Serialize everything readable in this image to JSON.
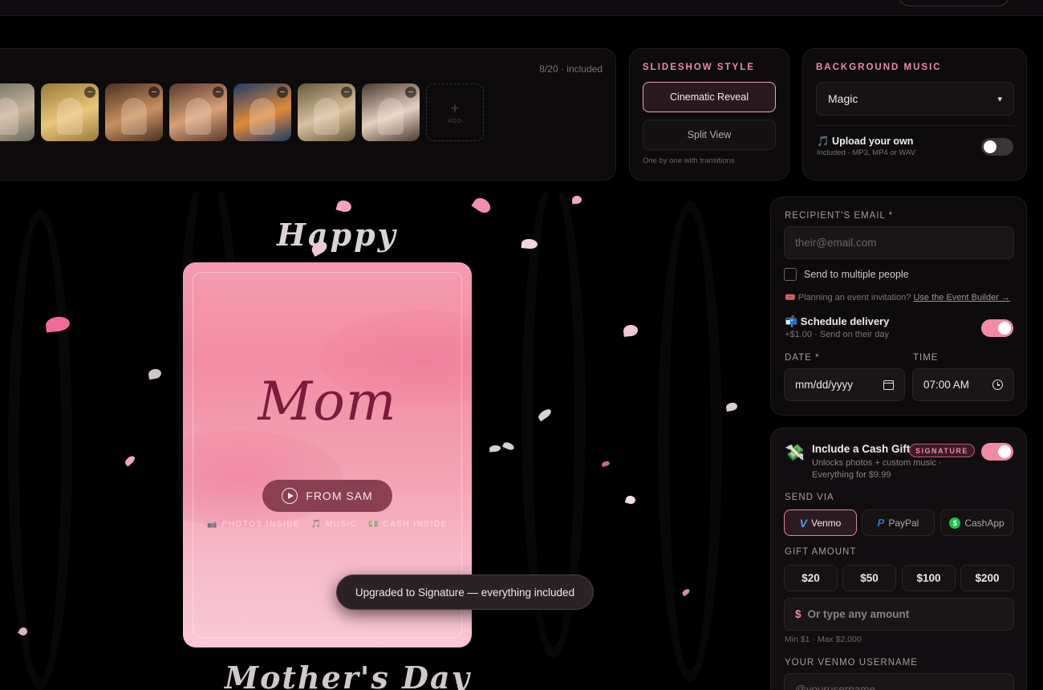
{
  "photos": {
    "count_label": "8/20 · included",
    "add_label": "ADD",
    "remove_glyph": "–",
    "thumbnails": [
      {
        "description": "family group",
        "colors": [
          "#6b6a5e",
          "#c8b49a"
        ]
      },
      {
        "description": "child in flower garden",
        "colors": [
          "#9a7a3a",
          "#e8c77a"
        ]
      },
      {
        "description": "family at dinner table",
        "colors": [
          "#4a3020",
          "#c89060"
        ]
      },
      {
        "description": "group of women hugging",
        "colors": [
          "#5a3a2a",
          "#d8a07a"
        ]
      },
      {
        "description": "couple at campfire",
        "colors": [
          "#1d3b6a",
          "#e08a3a"
        ]
      },
      {
        "description": "couple walking outdoors",
        "colors": [
          "#6a5a3a",
          "#d8c0a0"
        ]
      },
      {
        "description": "smiling woman portrait",
        "colors": [
          "#4a3a30",
          "#e8d0c0"
        ]
      }
    ]
  },
  "slideshow": {
    "title": "SLIDESHOW STYLE",
    "options": [
      "Cinematic Reveal",
      "Split View"
    ],
    "selected": "Cinematic Reveal",
    "hint": "One by one with transitions"
  },
  "music": {
    "title": "BACKGROUND MUSIC",
    "selected": "Magic",
    "caret": "▾",
    "upload_title": "🎵 Upload your own",
    "upload_sub": "Included · MP3, MP4 or WAV",
    "upload_enabled": false
  },
  "card": {
    "happy": "Happy",
    "name": "Mom",
    "from": "FROM SAM",
    "inside": "📷 PHOTOS INSIDE · 🎵 MUSIC · 💵 CASH INSIDE",
    "mothers_day": "Mother's Day",
    "colors": {
      "pink_top": "#f59cb0",
      "pink_bottom": "#f9c9d5",
      "script": "#7a1c3c"
    }
  },
  "toast": "Upgraded to Signature — everything included",
  "recipient": {
    "email_label": "RECIPIENT'S EMAIL *",
    "email_placeholder": "their@email.com",
    "multiple_label": "Send to multiple people",
    "multiple_checked": false,
    "invite_text": "🎟️ Planning an event invitation?",
    "invite_link": "Use the Event Builder →",
    "schedule_title": "📬 Schedule delivery",
    "schedule_sub": "+$1.00 · Send on their day",
    "schedule_enabled": true,
    "date_label": "DATE *",
    "date_value": "mm/dd/yyyy",
    "time_label": "TIME",
    "time_value": "07:00 AM"
  },
  "gift": {
    "icon": "💸",
    "title": "Include a Cash Gift",
    "badge": "SIGNATURE",
    "subtitle": "Unlocks photos + custom music · Everything for $9.99",
    "enabled": true,
    "send_via_label": "SEND VIA",
    "methods": [
      {
        "label": "Venmo",
        "mark": "V",
        "active": true
      },
      {
        "label": "PayPal",
        "mark": "P",
        "active": false
      },
      {
        "label": "CashApp",
        "mark": "$",
        "active": false
      }
    ],
    "amount_label": "GIFT AMOUNT",
    "amounts": [
      "$20",
      "$50",
      "$100",
      "$200"
    ],
    "custom_symbol": "$",
    "custom_placeholder": "Or type any amount",
    "limits": "Min $1 · Max $2,000",
    "username_label": "YOUR VENMO USERNAME",
    "username_placeholder": "@yourusername"
  },
  "colors": {
    "accent": "#f08aa5",
    "background": "#000000",
    "panel": "#0d0b0c"
  }
}
